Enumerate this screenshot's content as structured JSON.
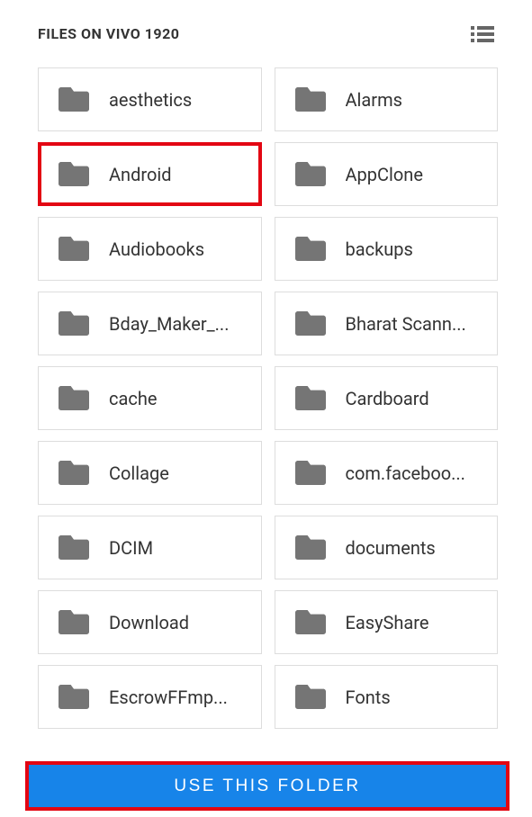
{
  "header": {
    "title": "FILES ON VIVO 1920"
  },
  "folders": [
    {
      "label": "aesthetics",
      "highlighted": false
    },
    {
      "label": "Alarms",
      "highlighted": false
    },
    {
      "label": "Android",
      "highlighted": true
    },
    {
      "label": "AppClone",
      "highlighted": false
    },
    {
      "label": "Audiobooks",
      "highlighted": false
    },
    {
      "label": "backups",
      "highlighted": false
    },
    {
      "label": "Bday_Maker_...",
      "highlighted": false
    },
    {
      "label": "Bharat Scann...",
      "highlighted": false
    },
    {
      "label": "cache",
      "highlighted": false
    },
    {
      "label": "Cardboard",
      "highlighted": false
    },
    {
      "label": "Collage",
      "highlighted": false
    },
    {
      "label": "com.faceboo...",
      "highlighted": false
    },
    {
      "label": "DCIM",
      "highlighted": false
    },
    {
      "label": "documents",
      "highlighted": false
    },
    {
      "label": "Download",
      "highlighted": false
    },
    {
      "label": "EasyShare",
      "highlighted": false
    },
    {
      "label": "EscrowFFmp...",
      "highlighted": false
    },
    {
      "label": "Fonts",
      "highlighted": false
    }
  ],
  "footer": {
    "button_label": "USE THIS FOLDER"
  }
}
